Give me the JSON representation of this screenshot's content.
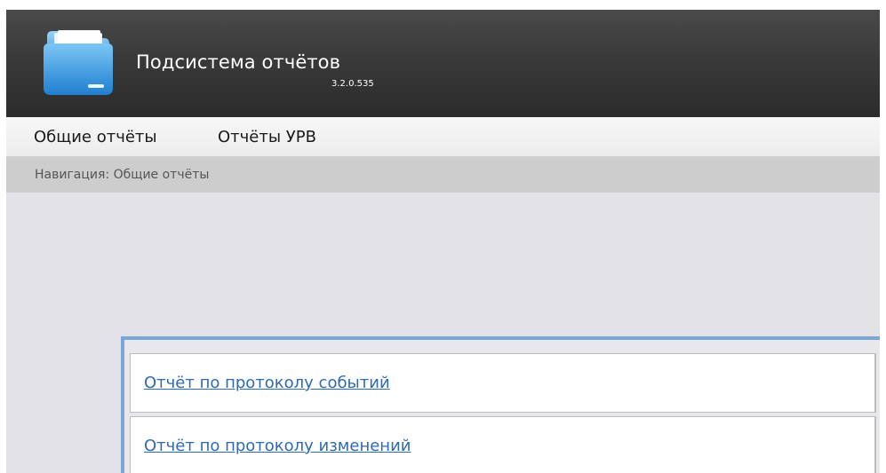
{
  "app": {
    "title": "Подсистема отчётов",
    "version": "3.2.0.535"
  },
  "menu": {
    "items": [
      {
        "label": "Общие отчёты"
      },
      {
        "label": "Отчёты УРВ"
      }
    ]
  },
  "breadcrumb": {
    "text": "Навигация: Общие отчёты"
  },
  "reports": {
    "links": [
      {
        "label": "Отчёт по протоколу событий"
      },
      {
        "label": "Отчёт по протоколу изменений"
      }
    ]
  },
  "colors": {
    "header_bg": "#333333",
    "menu_bg": "#f0f0f0",
    "breadcrumb_bg": "#cdcdcd",
    "content_bg": "#e3e3e7",
    "panel_border": "#7aa7d9",
    "link": "#2f6ab4"
  },
  "icons": {
    "logo": "folder-icon"
  }
}
